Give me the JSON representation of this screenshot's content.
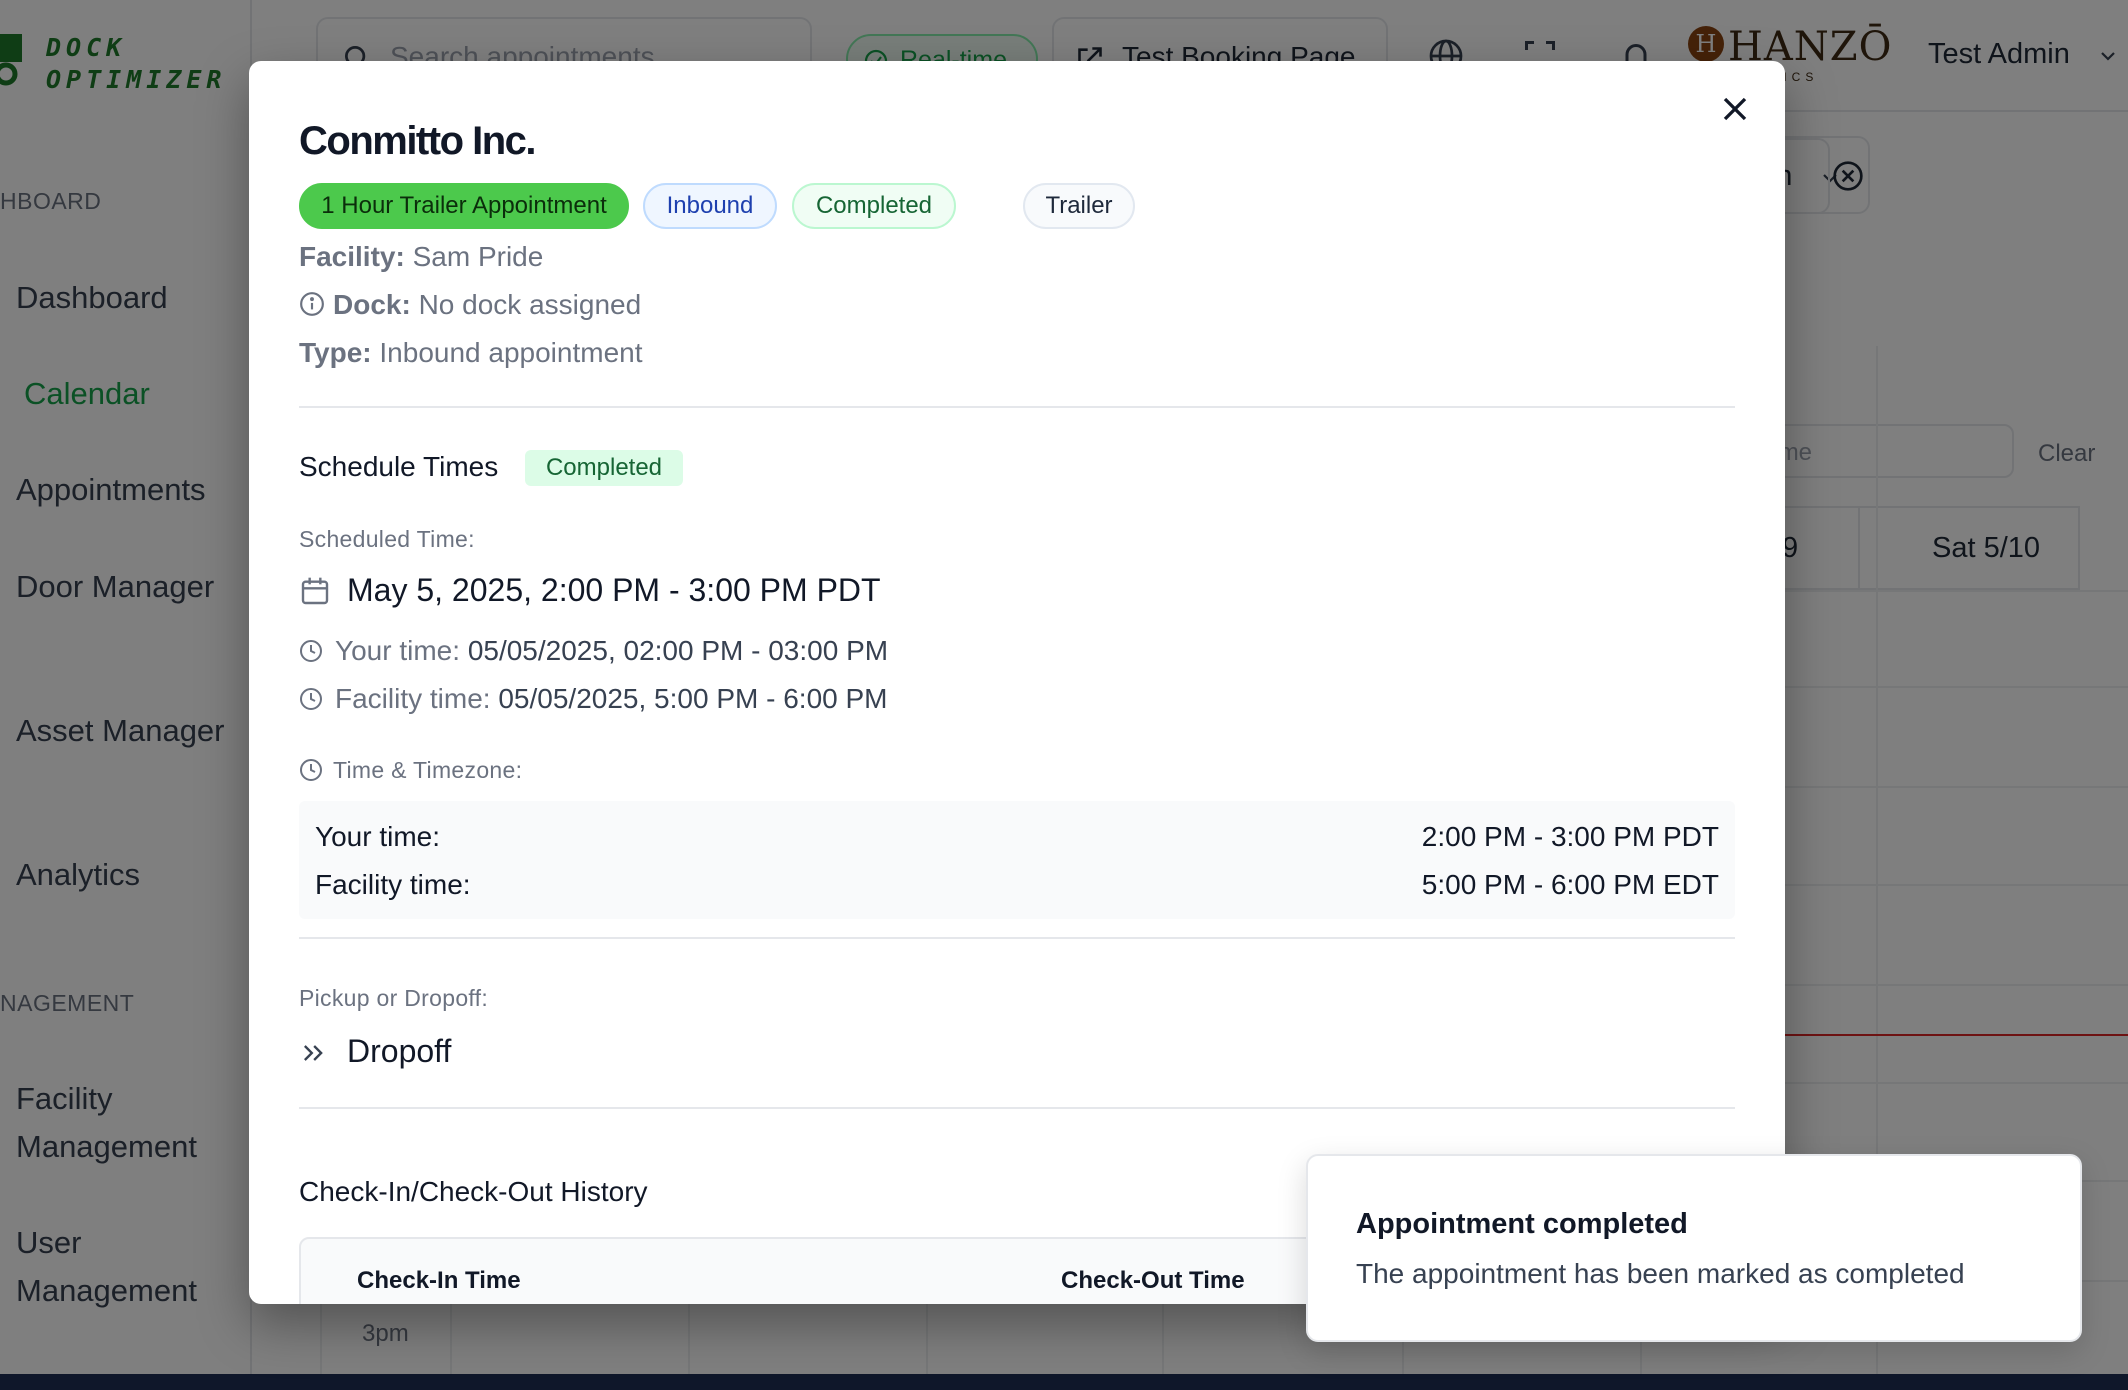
{
  "brand": {
    "logo_text": "DOCK\nOPTIMIZER",
    "partner_logo_name": "HANZŌ",
    "partner_logo_sub": "STICS"
  },
  "sidebar": {
    "section_dashboard": "HBOARD",
    "section_management": "NAGEMENT",
    "items": [
      {
        "label": "Dashboard"
      },
      {
        "label": "Calendar"
      },
      {
        "label": "Appointments"
      },
      {
        "label": "Door Manager"
      },
      {
        "label": "Asset Manager"
      },
      {
        "label": "Analytics"
      },
      {
        "label": "Facility Management"
      },
      {
        "label": "User Management"
      }
    ]
  },
  "topbar": {
    "search_placeholder": "Search appointments",
    "realtime_label": "Real-time",
    "booking_label": "Test Booking Page",
    "user_name": "Test Admin"
  },
  "calendar": {
    "time_format": "12h",
    "filter_placeholder": "er Name",
    "clear_label": "Clear",
    "day_partial": "9",
    "day_sat": "Sat 5/10",
    "time_3pm": "3pm"
  },
  "modal": {
    "title": "Conmitto Inc.",
    "badges": {
      "type": "1 Hour Trailer Appointment",
      "direction": "Inbound",
      "status": "Completed",
      "equipment": "Trailer"
    },
    "facility_label": "Facility:",
    "facility_value": "Sam Pride",
    "dock_label": "Dock:",
    "dock_value": "No dock assigned",
    "type_label": "Type:",
    "type_value": "Inbound appointment",
    "schedule_title": "Schedule Times",
    "schedule_status": "Completed",
    "scheduled_label": "Scheduled Time:",
    "scheduled_value": "May 5, 2025, 2:00 PM - 3:00 PM PDT",
    "your_time_label": "Your time:",
    "your_time_value": "05/05/2025, 02:00 PM - 03:00 PM",
    "facility_time_label": "Facility time:",
    "facility_time_value": "05/05/2025, 5:00 PM - 6:00 PM",
    "tz_label": "Time & Timezone:",
    "tz_rows": [
      {
        "key": "Your time:",
        "value": "2:00 PM - 3:00 PM PDT"
      },
      {
        "key": "Facility time:",
        "value": "5:00 PM - 6:00 PM EDT"
      }
    ],
    "pd_label": "Pickup or Dropoff:",
    "pd_value": "Dropoff",
    "history_title": "Check-In/Check-Out History",
    "history_headers": [
      "Check-In Time",
      "Check-Out Time"
    ]
  },
  "toast": {
    "title": "Appointment completed",
    "message": "The appointment has been marked as completed"
  },
  "colors": {
    "brand_green": "#16a34a",
    "badge_type_bg": "#4cc94c"
  }
}
